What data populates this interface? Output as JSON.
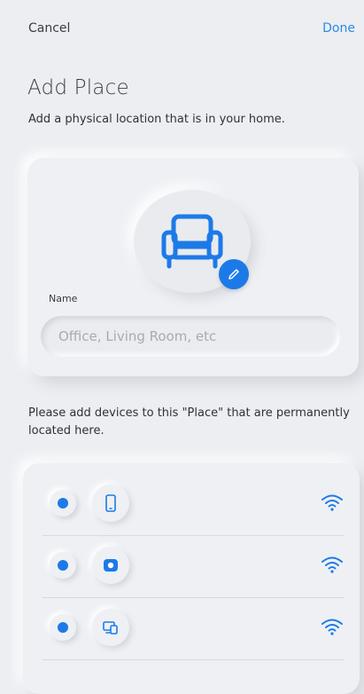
{
  "header": {
    "cancel_label": "Cancel",
    "done_label": "Done"
  },
  "page": {
    "title": "Add Place",
    "subtitle": "Add a physical location that is in your home."
  },
  "place_card": {
    "icon": "armchair-icon",
    "edit_icon": "pencil-icon",
    "name_label": "Name",
    "name_value": "",
    "name_placeholder": "Office, Living Room, etc"
  },
  "devices": {
    "note": "Please add devices to this \"Place\" that are permanently located here.",
    "items": [
      {
        "icon": "phone-icon",
        "selected": true,
        "status_icon": "wifi-icon"
      },
      {
        "icon": "media-player-icon",
        "selected": true,
        "status_icon": "wifi-icon"
      },
      {
        "icon": "devices-icon",
        "selected": true,
        "status_icon": "wifi-icon"
      }
    ]
  },
  "colors": {
    "accent": "#1c7ae8",
    "background": "#eceef2"
  }
}
